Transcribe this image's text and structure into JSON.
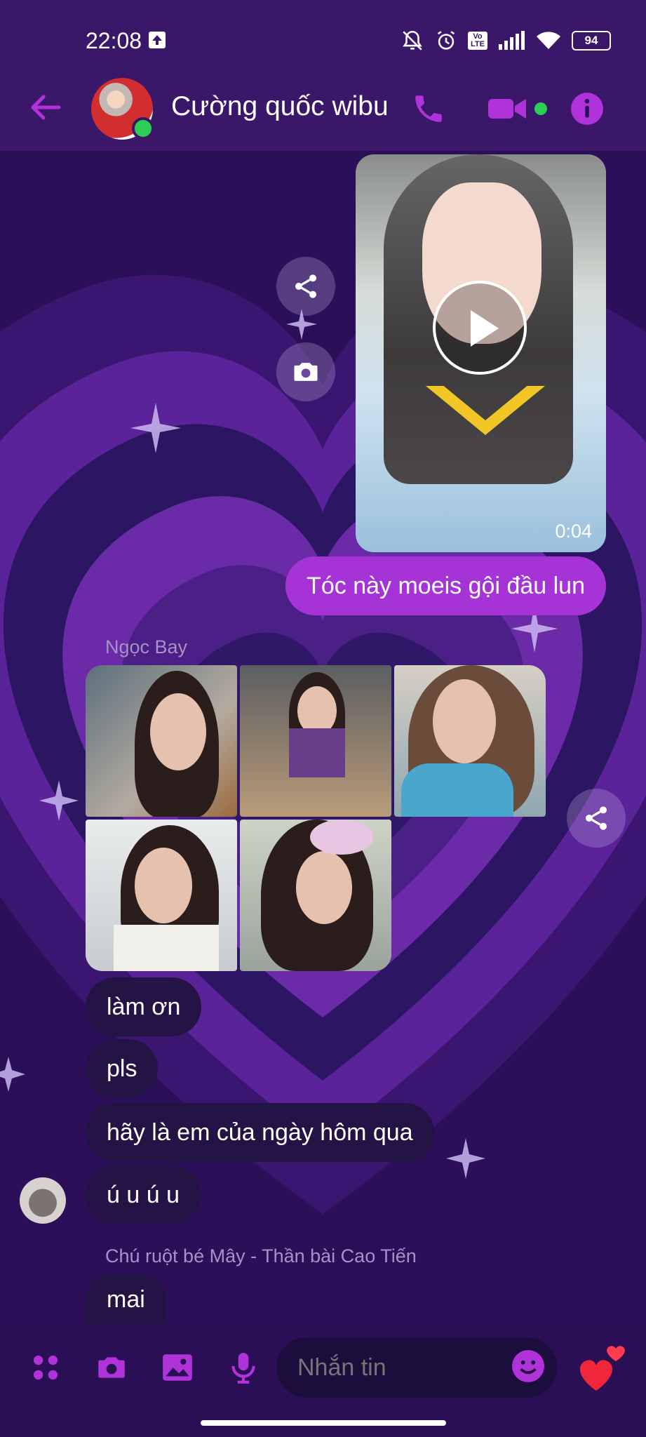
{
  "status_bar": {
    "time": "22:08",
    "battery": "94",
    "volte": "Vo LTE"
  },
  "header": {
    "title": "Cường quốc wibu",
    "online": true
  },
  "colors": {
    "accent": "#b033d9",
    "background": "#2a0f57",
    "sent_bubble": "#a633d6",
    "received_bubble": "#231445",
    "online": "#2ccf54"
  },
  "video_message": {
    "duration": "0:04"
  },
  "messages": {
    "sent_text": "Tóc này moeis gội đầu lun",
    "sender_1": "Ngọc Bay",
    "received": [
      "làm ơn",
      "pls",
      "hãy là em của ngày hôm qua",
      "ú u ú u"
    ],
    "sender_2": "Chú ruột bé Mây - Thần bài Cao Tiến",
    "last_received": "mai"
  },
  "composer": {
    "placeholder": "Nhắn tin"
  },
  "icons": {
    "back": "arrow-left-icon",
    "call": "phone-icon",
    "video": "video-camera-icon",
    "info": "info-icon",
    "share": "share-icon",
    "camera": "camera-icon",
    "apps": "apps-icon",
    "gallery": "gallery-icon",
    "mic": "microphone-icon",
    "emoji": "emoji-icon",
    "reaction": "heart-icon"
  }
}
